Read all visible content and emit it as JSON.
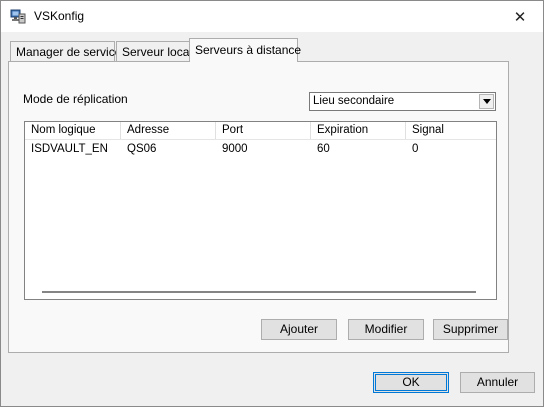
{
  "window": {
    "title": "VSKonfig",
    "close_symbol": "✕"
  },
  "tabs": [
    {
      "label": "Manager de service"
    },
    {
      "label": "Serveur local"
    },
    {
      "label": "Serveurs à distance",
      "active": true
    }
  ],
  "panel": {
    "mode_label": "Mode de réplication",
    "mode_value": "Lieu secondaire",
    "table": {
      "columns": [
        "Nom logique",
        "Adresse",
        "Port",
        "Expiration",
        "Signal"
      ],
      "rows": [
        [
          "ISDVAULT_EN",
          "QS06",
          "9000",
          "60",
          "0"
        ]
      ]
    },
    "buttons": {
      "add": "Ajouter",
      "modify": "Modifier",
      "delete": "Supprimer"
    }
  },
  "dialog_buttons": {
    "ok": "OK",
    "cancel": "Annuler"
  },
  "colors": {
    "focus_border": "#0078d7",
    "button_face": "#e1e1e1"
  }
}
